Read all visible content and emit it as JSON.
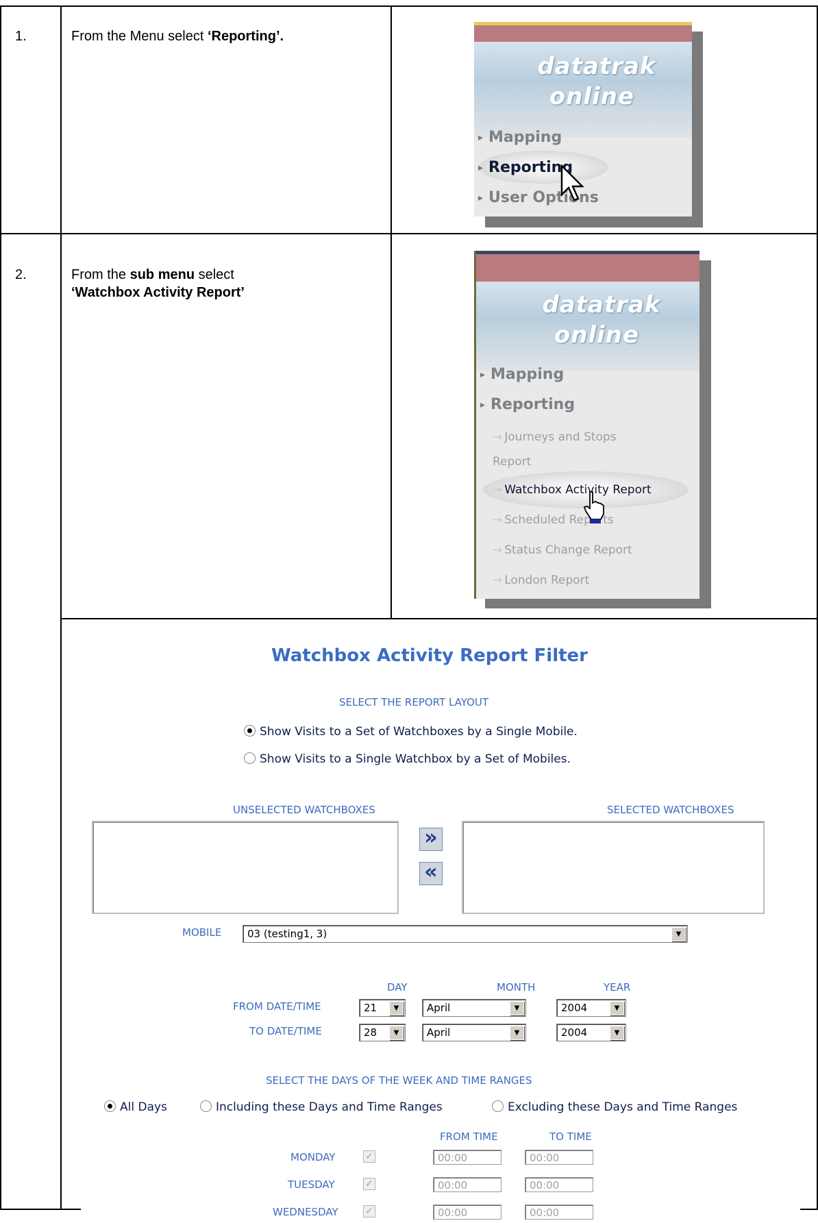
{
  "steps": [
    {
      "number": "1.",
      "text_pre": "From the Menu select ",
      "text_bold": "‘Reporting’.",
      "menu": {
        "logo_line1": "datatrak",
        "logo_line2": "online",
        "items": [
          "Mapping",
          "Reporting",
          "User Options"
        ],
        "active": "Reporting"
      }
    },
    {
      "number": "2.",
      "text_pre": "From the ",
      "text_bold1": "sub menu",
      "text_mid": " select",
      "text_bold2": "‘Watchbox Activity Report’",
      "menu": {
        "logo_line1": "datatrak",
        "logo_line2": "online",
        "items": [
          "Mapping",
          "Reporting"
        ],
        "subitems": [
          "Journeys and Stops",
          "Report",
          "Watchbox Activity Report",
          "Scheduled Reports",
          "Status Change Report",
          "London Report"
        ],
        "active": "Watchbox Activity Report"
      }
    }
  ],
  "filter": {
    "title": "Watchbox Activity Report Filter",
    "layout_heading": "SELECT THE REPORT LAYOUT",
    "layout_options": [
      {
        "label": "Show Visits to a Set of Watchboxes by a Single Mobile.",
        "selected": true
      },
      {
        "label": "Show Visits to a Single Watchbox by a Set of Mobiles.",
        "selected": false
      }
    ],
    "unselected_label": "UNSELECTED WATCHBOXES",
    "selected_label": "SELECTED WATCHBOXES",
    "mobile_label": "MOBILE",
    "mobile_value": "03 (testing1, 3)",
    "day_label": "DAY",
    "month_label": "MONTH",
    "year_label": "YEAR",
    "from_label": "FROM DATE/TIME",
    "to_label": "TO DATE/TIME",
    "from": {
      "day": "21",
      "month": "April",
      "year": "2004"
    },
    "to": {
      "day": "28",
      "month": "April",
      "year": "2004"
    },
    "days_heading": "SELECT THE DAYS OF THE WEEK AND TIME RANGES",
    "day_options": [
      {
        "label": "All Days",
        "selected": true
      },
      {
        "label": "Including these Days and Time Ranges",
        "selected": false
      },
      {
        "label": "Excluding these Days and Time Ranges",
        "selected": false
      }
    ],
    "from_time_label": "FROM TIME",
    "to_time_label": "TO TIME",
    "weekdays": [
      {
        "name": "MONDAY",
        "from": "00:00",
        "to": "00:00"
      },
      {
        "name": "TUESDAY",
        "from": "00:00",
        "to": "00:00"
      },
      {
        "name": "WEDNESDAY",
        "from": "00:00",
        "to": "00:00"
      }
    ]
  }
}
